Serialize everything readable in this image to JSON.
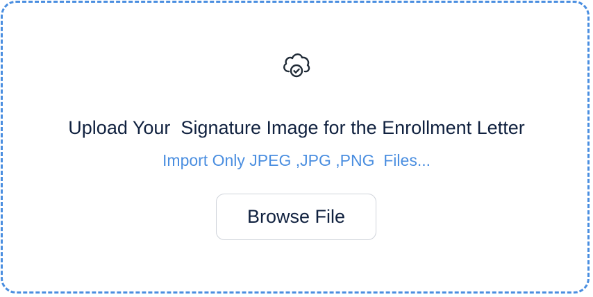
{
  "upload": {
    "icon": "cloud-check-icon",
    "title": "Upload Your  Signature Image for the Enrollment Letter",
    "subtitle": "Import Only JPEG ,JPG ,PNG  Files...",
    "browse_label": "Browse File"
  },
  "colors": {
    "accent": "#4a8ee0",
    "text": "#10213f",
    "button_border": "#cfd3da"
  }
}
